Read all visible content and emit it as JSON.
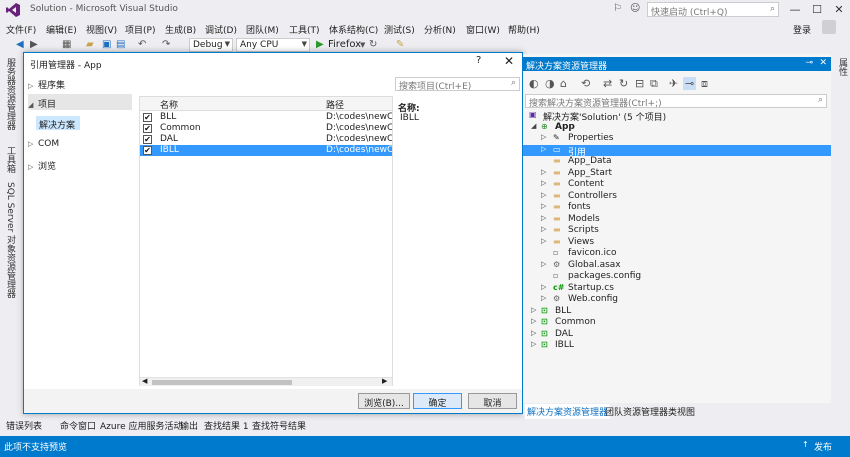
{
  "window": {
    "title": "Solution - Microsoft Visual Studio",
    "quick_launch_placeholder": "快速启动 (Ctrl+Q)",
    "login": "登录",
    "minimize": "—",
    "maximize": "☐",
    "close": "✕"
  },
  "menu": [
    "文件(F)",
    "编辑(E)",
    "视图(V)",
    "项目(P)",
    "生成(B)",
    "调试(D)",
    "团队(M)",
    "工具(T)",
    "体系结构(C)",
    "测试(S)",
    "分析(N)",
    "窗口(W)",
    "帮助(H)"
  ],
  "toolbar": {
    "config": "Debug",
    "platform": "Any CPU",
    "run_target": "Firefox"
  },
  "left_strip": [
    "服务器资源管理器",
    "工具箱",
    "SQL Server 对象资源管理器"
  ],
  "right_strip": [
    "属性"
  ],
  "dialog": {
    "title": "引用管理器 - App",
    "help": "?",
    "close": "✕",
    "nav": [
      {
        "label": "程序集",
        "expanded": false
      },
      {
        "label": "项目",
        "expanded": true,
        "children": [
          "解决方案"
        ]
      },
      {
        "label": "COM",
        "expanded": false
      },
      {
        "label": "浏览",
        "expanded": false
      }
    ],
    "columns": {
      "name": "名称",
      "path": "路径"
    },
    "rows": [
      {
        "name": "BLL",
        "path": "D:\\codes\\newCod",
        "checked": true,
        "selected": false
      },
      {
        "name": "Common",
        "path": "D:\\codes\\newCod",
        "checked": true,
        "selected": false
      },
      {
        "name": "DAL",
        "path": "D:\\codes\\newCod",
        "checked": true,
        "selected": false
      },
      {
        "name": "IBLL",
        "path": "D:\\codes\\newCod",
        "checked": true,
        "selected": true
      }
    ],
    "search_placeholder": "搜索项目(Ctrl+E)",
    "details": {
      "name_label": "名称:",
      "name_value": "IBLL"
    },
    "buttons": {
      "browse": "浏览(B)...",
      "ok": "确定",
      "cancel": "取消"
    }
  },
  "solution_explorer": {
    "title": "解决方案资源管理器",
    "search_placeholder": "搜索解决方案资源管理器(Ctrl+;)",
    "tree": [
      {
        "label": "解决方案'Solution' (5 个项目)",
        "icon": "solution-icon",
        "depth": 0,
        "expander": "",
        "selected": false
      },
      {
        "label": "App",
        "icon": "web-project-icon",
        "depth": 1,
        "expander": "expanded",
        "bold": true,
        "selected": false
      },
      {
        "label": "Properties",
        "icon": "wrench-icon",
        "depth": 2,
        "expander": "collapsed",
        "selected": false
      },
      {
        "label": "引用",
        "icon": "references-icon",
        "depth": 2,
        "expander": "collapsed",
        "selected": true
      },
      {
        "label": "App_Data",
        "icon": "folder-icon",
        "depth": 2,
        "expander": "",
        "selected": false
      },
      {
        "label": "App_Start",
        "icon": "folder-icon",
        "depth": 2,
        "expander": "collapsed",
        "selected": false
      },
      {
        "label": "Content",
        "icon": "folder-icon",
        "depth": 2,
        "expander": "collapsed",
        "selected": false
      },
      {
        "label": "Controllers",
        "icon": "folder-icon",
        "depth": 2,
        "expander": "collapsed",
        "selected": false
      },
      {
        "label": "fonts",
        "icon": "folder-icon",
        "depth": 2,
        "expander": "collapsed",
        "selected": false
      },
      {
        "label": "Models",
        "icon": "folder-icon",
        "depth": 2,
        "expander": "collapsed",
        "selected": false
      },
      {
        "label": "Scripts",
        "icon": "folder-icon",
        "depth": 2,
        "expander": "collapsed",
        "selected": false
      },
      {
        "label": "Views",
        "icon": "folder-icon",
        "depth": 2,
        "expander": "collapsed",
        "selected": false
      },
      {
        "label": "favicon.ico",
        "icon": "file-icon",
        "depth": 2,
        "expander": "",
        "selected": false
      },
      {
        "label": "Global.asax",
        "icon": "file-icon",
        "depth": 2,
        "expander": "collapsed",
        "selected": false
      },
      {
        "label": "packages.config",
        "icon": "config-icon",
        "depth": 2,
        "expander": "",
        "selected": false
      },
      {
        "label": "Startup.cs",
        "icon": "csharp-file-icon",
        "depth": 2,
        "expander": "collapsed",
        "selected": false
      },
      {
        "label": "Web.config",
        "icon": "config-icon",
        "depth": 2,
        "expander": "collapsed",
        "selected": false
      },
      {
        "label": "BLL",
        "icon": "csharp-project-icon",
        "depth": 1,
        "expander": "collapsed",
        "selected": false
      },
      {
        "label": "Common",
        "icon": "csharp-project-icon",
        "depth": 1,
        "expander": "collapsed",
        "selected": false
      },
      {
        "label": "DAL",
        "icon": "csharp-project-icon",
        "depth": 1,
        "expander": "collapsed",
        "selected": false
      },
      {
        "label": "IBLL",
        "icon": "csharp-project-icon",
        "depth": 1,
        "expander": "collapsed",
        "selected": false
      }
    ],
    "tabs": [
      {
        "label": "解决方案资源管理器",
        "active": true
      },
      {
        "label": "团队资源管理器",
        "active": false
      },
      {
        "label": "类视图",
        "active": false
      }
    ]
  },
  "bottom_tabs": [
    "错误列表",
    "命令窗口",
    "Azure 应用服务活动",
    "输出",
    "查找结果 1",
    "查找符号结果"
  ],
  "status": {
    "text": "此项不支持预览",
    "publish": "发布",
    "publish_arrow": "↑"
  },
  "colors": {
    "accent": "#007acc",
    "selection": "#3399ff",
    "chrome": "#eeeef2"
  }
}
